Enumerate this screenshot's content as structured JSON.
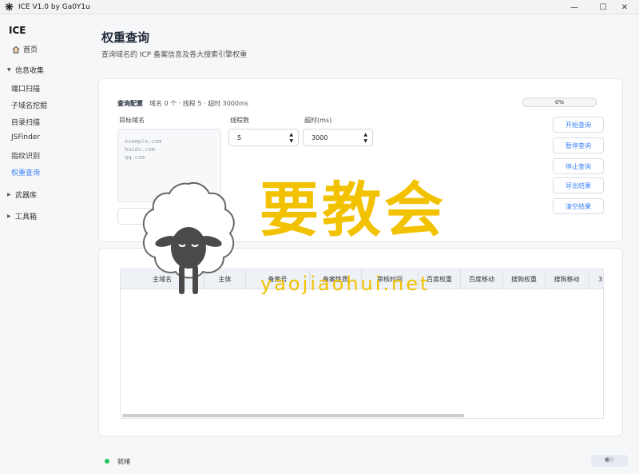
{
  "window": {
    "title": "ICE V1.0 by Ga0Y1u"
  },
  "sidebar": {
    "brand": "ICE",
    "home": "首页",
    "info_group": "信息收集",
    "info_items": [
      "端口扫描",
      "子域名挖掘",
      "目录扫描",
      "JSFinder",
      "指纹识别",
      "权重查询"
    ],
    "weapons_group": "武器库",
    "tools_group": "工具箱"
  },
  "page": {
    "title": "权重查询",
    "subtitle": "查询域名的 ICP 备案信息及各大搜索引擎权重"
  },
  "config": {
    "title": "查询配置",
    "meta": "域名 0 个 · 线程 5 · 超时 3000ms",
    "progress": "0%",
    "domain_label": "目标域名",
    "domain_placeholder": "example.com\nbaidu.com\nqq.com",
    "threads_label": "线程数",
    "threads_value": "5",
    "timeout_label": "超时(ms)",
    "timeout_value": "3000",
    "import_button": "导入域名",
    "buttons": {
      "start": "开始查询",
      "pause": "暂停查询",
      "stop": "停止查询",
      "export": "导出结果",
      "clear": "清空结果"
    }
  },
  "table": {
    "columns": [
      "主域名",
      "主体",
      "备案号",
      "备案性质",
      "审核时间",
      "百度权重",
      "百度移动",
      "搜狗权重",
      "搜狗移动",
      "3"
    ]
  },
  "status": {
    "text": "就绪"
  },
  "watermark": {
    "text": "要教会",
    "url": "yaojiaohui.net"
  }
}
